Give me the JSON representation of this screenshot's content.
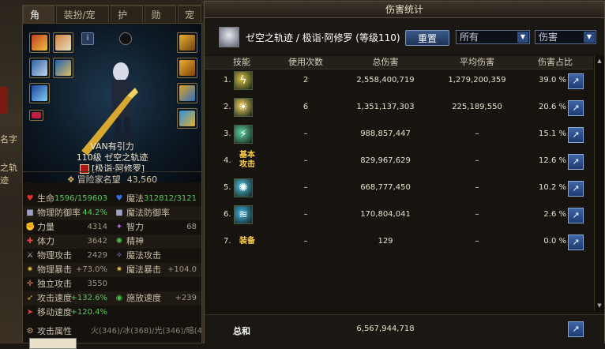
{
  "left_edge": {
    "text1": "名字",
    "text2": "之轨迹"
  },
  "char_panel": {
    "tabs": [
      "角色",
      "装扮/宠物",
      "护石",
      "勋章",
      "宠"
    ],
    "char_name": "VAN有引力",
    "level_line": "110级 ゼ空之轨迹",
    "guild": "[极诣·阿修罗]",
    "fame_label": "冒险家名望",
    "fame_value": "43,560",
    "stats": [
      {
        "l": {
          "icon": "heart-icon",
          "label": "生命",
          "value": "1596/159603",
          "color": "green"
        },
        "r": {
          "icon": "mana-icon",
          "label": "魔法",
          "value": "312812/3121",
          "color": "green"
        }
      },
      {
        "l": {
          "icon": "shield-icon",
          "label": "物理防御率",
          "value": "44.2%",
          "color": "green"
        },
        "r": {
          "icon": "shield-icon",
          "label": "魔法防御率",
          "value": "",
          "color": ""
        }
      },
      {
        "l": {
          "icon": "strength-icon",
          "label": "力量",
          "value": "4314",
          "color": ""
        },
        "r": {
          "icon": "intel-icon",
          "label": "智力",
          "value": "68",
          "color": ""
        }
      },
      {
        "l": {
          "icon": "vitality-icon",
          "label": "体力",
          "value": "3642",
          "color": ""
        },
        "r": {
          "icon": "spirit-icon",
          "label": "精神",
          "value": "",
          "color": ""
        }
      },
      {
        "l": {
          "icon": "sword-icon",
          "label": "物理攻击",
          "value": "2429",
          "color": ""
        },
        "r": {
          "icon": "magic-icon",
          "label": "魔法攻击",
          "value": "",
          "color": ""
        }
      },
      {
        "l": {
          "icon": "crit-icon",
          "label": "物理暴击",
          "value": "+73.0%",
          "color": ""
        },
        "r": {
          "icon": "crit-icon",
          "label": "魔法暴击",
          "value": "+104.0",
          "color": ""
        }
      },
      {
        "l": {
          "icon": "indep-icon",
          "label": "独立攻击",
          "value": "3550",
          "color": ""
        },
        "r": {
          "icon": "",
          "label": "",
          "value": "",
          "color": ""
        }
      },
      {
        "l": {
          "icon": "speed-icon",
          "label": "攻击速度",
          "value": "+132.6%",
          "color": "green"
        },
        "r": {
          "icon": "cast-icon",
          "label": "施放速度",
          "value": "+239",
          "color": ""
        }
      },
      {
        "l": {
          "icon": "move-icon",
          "label": "移动速度",
          "value": "+120.4%",
          "color": "green"
        },
        "r": {
          "icon": "",
          "label": "",
          "value": "",
          "color": ""
        }
      }
    ],
    "attr_label": "攻击属性",
    "attr_value": "火(346)/冰(368)/光(346)/暗(4"
  },
  "damage_window": {
    "title": "伤害统计",
    "header_text": "ゼ空之轨迹 / 极诣·阿修罗 (等级110)",
    "reset_label": "重置",
    "filter1": "所有",
    "filter2": "伤害",
    "columns": [
      "技能",
      "使用次数",
      "总伤害",
      "平均伤害",
      "伤害占比"
    ],
    "rows": [
      {
        "no": "1.",
        "skill_icon": "lightning-skill-icon",
        "skill_text": "",
        "uses": "2",
        "total": "2,558,400,719",
        "avg": "1,279,200,359",
        "pct": "39.0 %"
      },
      {
        "no": "2.",
        "skill_icon": "burst-skill-icon",
        "skill_text": "",
        "uses": "6",
        "total": "1,351,137,303",
        "avg": "225,189,550",
        "pct": "20.6 %"
      },
      {
        "no": "3.",
        "skill_icon": "slash-skill-icon",
        "skill_text": "",
        "uses": "–",
        "total": "988,857,447",
        "avg": "–",
        "pct": "15.1 %"
      },
      {
        "no": "4.",
        "skill_icon": "",
        "skill_text": "基本攻击",
        "uses": "–",
        "total": "829,967,629",
        "avg": "–",
        "pct": "12.6 %"
      },
      {
        "no": "5.",
        "skill_icon": "orb-skill-icon",
        "skill_text": "",
        "uses": "–",
        "total": "668,777,450",
        "avg": "–",
        "pct": "10.2 %"
      },
      {
        "no": "6.",
        "skill_icon": "wave-skill-icon",
        "skill_text": "",
        "uses": "–",
        "total": "170,804,041",
        "avg": "–",
        "pct": "2.6 %"
      },
      {
        "no": "7.",
        "skill_icon": "",
        "skill_text": "装备",
        "uses": "–",
        "total": "129",
        "avg": "–",
        "pct": "0.0 %"
      }
    ],
    "sum_label": "总和",
    "sum_total": "6,567,944,718"
  }
}
